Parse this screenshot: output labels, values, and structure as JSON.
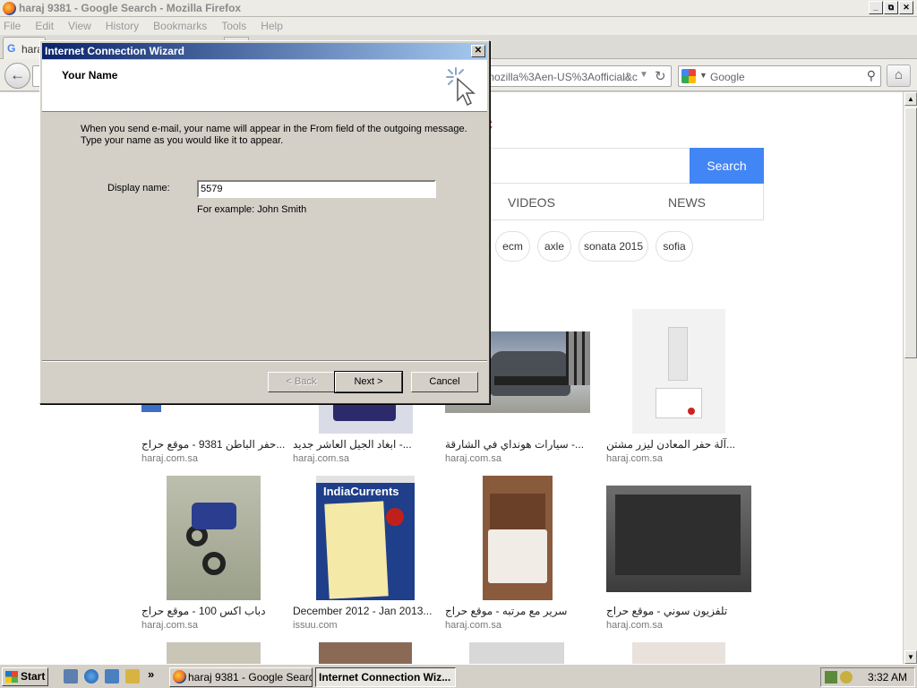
{
  "browser": {
    "title": "haraj 9381 - Google Search - Mozilla Firefox",
    "window_buttons": [
      "_",
      "⧉",
      "✕"
    ],
    "menu": [
      "File",
      "Edit",
      "View",
      "History",
      "Bookmarks",
      "Tools",
      "Help"
    ],
    "tab_label": "hara",
    "url_fragment": "mozilla%3Aen-US%3Aofficial&c",
    "search_placeholder": "Google"
  },
  "page": {
    "logo_fragment": "c",
    "search_button": "Search",
    "tabs": [
      "VIDEOS",
      "NEWS"
    ],
    "chips": [
      "ecm",
      "axle",
      "sonata 2015",
      "sofia"
    ],
    "results": [
      {
        "caption": "حفر الباطن 9381 - موقع حراج...",
        "source": "haraj.com.sa"
      },
      {
        "caption": "ابغاد الجيل العاشر جديد -...",
        "source": "haraj.com.sa"
      },
      {
        "caption": "سيارات هونداي في الشارقة -...",
        "source": "haraj.com.sa"
      },
      {
        "caption": "آلة حفر المعادن ليزر مشتن...",
        "source": "haraj.com.sa"
      },
      {
        "caption": "دباب اكس 100 - موقع حراج",
        "source": "haraj.com.sa"
      },
      {
        "caption": "December 2012 - Jan 2013...",
        "source": "issuu.com"
      },
      {
        "caption": "سرير مع مرتبه - موقع حراج",
        "source": "haraj.com.sa"
      },
      {
        "caption": "تلفزيون سوني - موقع حراج",
        "source": "haraj.com.sa"
      }
    ],
    "magazine_title": "IndiaCurrents"
  },
  "wizard": {
    "title": "Internet Connection Wizard",
    "close": "✕",
    "heading": "Your Name",
    "description": "When you send e-mail, your name will appear in the From field of the outgoing message. Type your name as you would like it to appear.",
    "display_name_label": "Display name:",
    "display_name_value": "5579",
    "example": "For example: John Smith",
    "back_label": "< Back",
    "next_label": "Next >",
    "cancel_label": "Cancel"
  },
  "taskbar": {
    "start": "Start",
    "chevron": "»",
    "task1": "haraj 9381 - Google Searc...",
    "task2": "Internet Connection Wiz...",
    "clock": "3:32 AM"
  }
}
